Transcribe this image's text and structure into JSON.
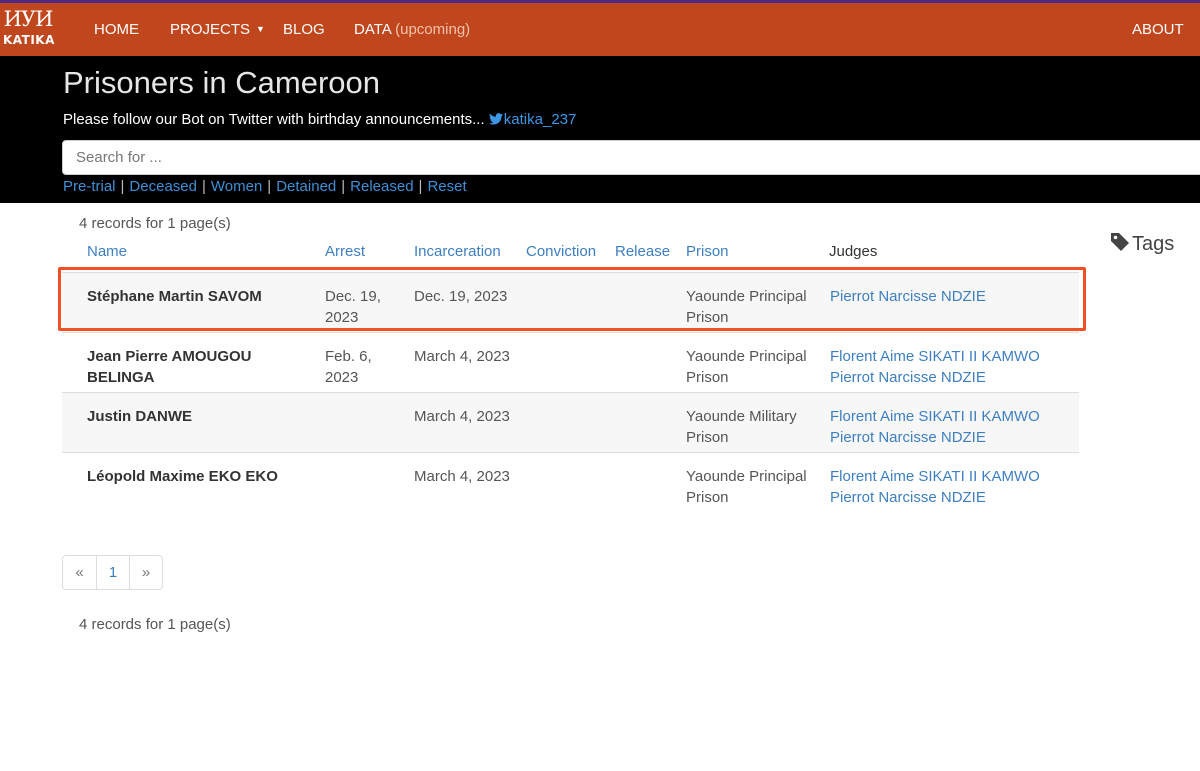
{
  "nav": {
    "logo_mark": "ИУИ",
    "logo_text": "KATIKA",
    "items": [
      {
        "label": "HOME"
      },
      {
        "label": "PROJECTS"
      },
      {
        "label": "BLOG"
      },
      {
        "label": "DATA",
        "suffix": "(upcoming)"
      }
    ],
    "about": "ABOUT"
  },
  "header": {
    "title": "Prisoners in Cameroon",
    "subtitle": "Please follow our Bot on Twitter with birthday announcements...",
    "twitter_handle": "katika_237",
    "search_placeholder": "Search for ..."
  },
  "filters": [
    "Pre-trial",
    "Deceased",
    "Women",
    "Detained",
    "Released",
    "Reset"
  ],
  "records_info": "4 records for 1 page(s)",
  "table": {
    "columns": [
      "Name",
      "Arrest",
      "Incarceration",
      "Conviction",
      "Release",
      "Prison",
      "Judges"
    ],
    "rows": [
      {
        "name": "Stéphane Martin SAVOM",
        "arrest": "Dec. 19, 2023",
        "incarceration": "Dec. 19, 2023",
        "conviction": "",
        "release": "",
        "prison": "Yaounde Principal Prison",
        "judges": [
          "Pierrot Narcisse NDZIE"
        ]
      },
      {
        "name": "Jean Pierre AMOUGOU BELINGA",
        "arrest": "Feb. 6, 2023",
        "incarceration": "March 4, 2023",
        "conviction": "",
        "release": "",
        "prison": "Yaounde Principal Prison",
        "judges": [
          "Florent Aime SIKATI II KAMWO",
          "Pierrot Narcisse NDZIE"
        ]
      },
      {
        "name": "Justin DANWE",
        "arrest": "",
        "incarceration": "March 4, 2023",
        "conviction": "",
        "release": "",
        "prison": "Yaounde Military Prison",
        "judges": [
          "Florent Aime SIKATI II KAMWO",
          "Pierrot Narcisse NDZIE"
        ]
      },
      {
        "name": "Léopold Maxime EKO EKO",
        "arrest": "",
        "incarceration": "March 4, 2023",
        "conviction": "",
        "release": "",
        "prison": "Yaounde Principal Prison",
        "judges": [
          "Florent Aime SIKATI II KAMWO",
          "Pierrot Narcisse NDZIE"
        ]
      }
    ]
  },
  "tags_label": "Tags",
  "pagination": {
    "prev": "«",
    "page": "1",
    "next": "»"
  },
  "colors": {
    "navbar": "#c0461d",
    "header": "#000000",
    "link": "#3d7fc1",
    "highlight": "#f05023"
  }
}
